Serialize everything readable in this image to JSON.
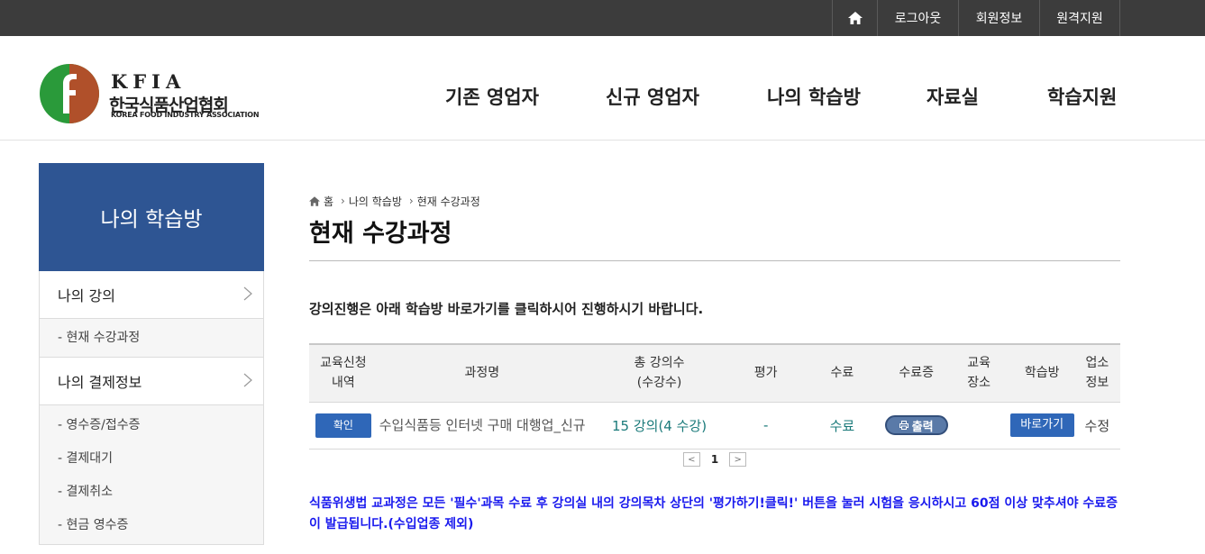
{
  "topbar": {
    "home_icon": "home-icon",
    "logout": "로그아웃",
    "member_info": "회원정보",
    "remote_support": "원격지원"
  },
  "logo": {
    "abbr": "KFIA",
    "name_ko": "한국식품산업협회",
    "name_en": "KOREA FOOD INDUSTRY ASSOCIATION",
    "colors": {
      "green": "#2a9a3a",
      "brown": "#b0502a"
    }
  },
  "gnb": [
    "기존 영업자",
    "신규 영업자",
    "나의 학습방",
    "자료실",
    "학습지원"
  ],
  "sidebar": {
    "title": "나의 학습방",
    "menu1": {
      "label": "나의 강의",
      "subs": [
        "현재 수강과정"
      ]
    },
    "menu2": {
      "label": "나의 결제정보",
      "subs": [
        "영수증/접수증",
        "결제대기",
        "결제취소",
        "현금 영수증"
      ]
    }
  },
  "breadcrumb": {
    "home": "홈",
    "level1": "나의 학습방",
    "level2": "현재 수강과정"
  },
  "page_title": "현재 수강과정",
  "notice": "강의진행은 아래 학습방 바로가기를 클릭하시어 진행하시기 바랍니다.",
  "table": {
    "headers": {
      "apply_line1": "교육신청",
      "apply_line2": "내역",
      "course": "과정명",
      "lectures_line1": "총 강의수",
      "lectures_line2": "(수강수)",
      "eval": "평가",
      "complete": "수료",
      "cert": "수료증",
      "place_line1": "교육",
      "place_line2": "장소",
      "room": "학습방",
      "biz_line1": "업소",
      "biz_line2": "정보"
    },
    "row": {
      "confirm": "확인",
      "course": "수입식품등 인터넷 구매 대행업_신규",
      "lectures": "15 강의(4 수강)",
      "eval": "-",
      "complete": "수료",
      "cert": "출력",
      "place": "",
      "room": "바로가기",
      "biz": "수정"
    }
  },
  "pager": {
    "prev": "<",
    "current": "1",
    "next": ">"
  },
  "footer_notice": "식품위생법 교과정은 모든 '필수'과목 수료 후 강의실 내의 강의목차 상단의 '평가하기!클릭!' 버튼을 눌러 시험을 응시하시고 60점 이상 맞추셔야 수료증이 발급됩니다.(수입업종 제외)"
}
